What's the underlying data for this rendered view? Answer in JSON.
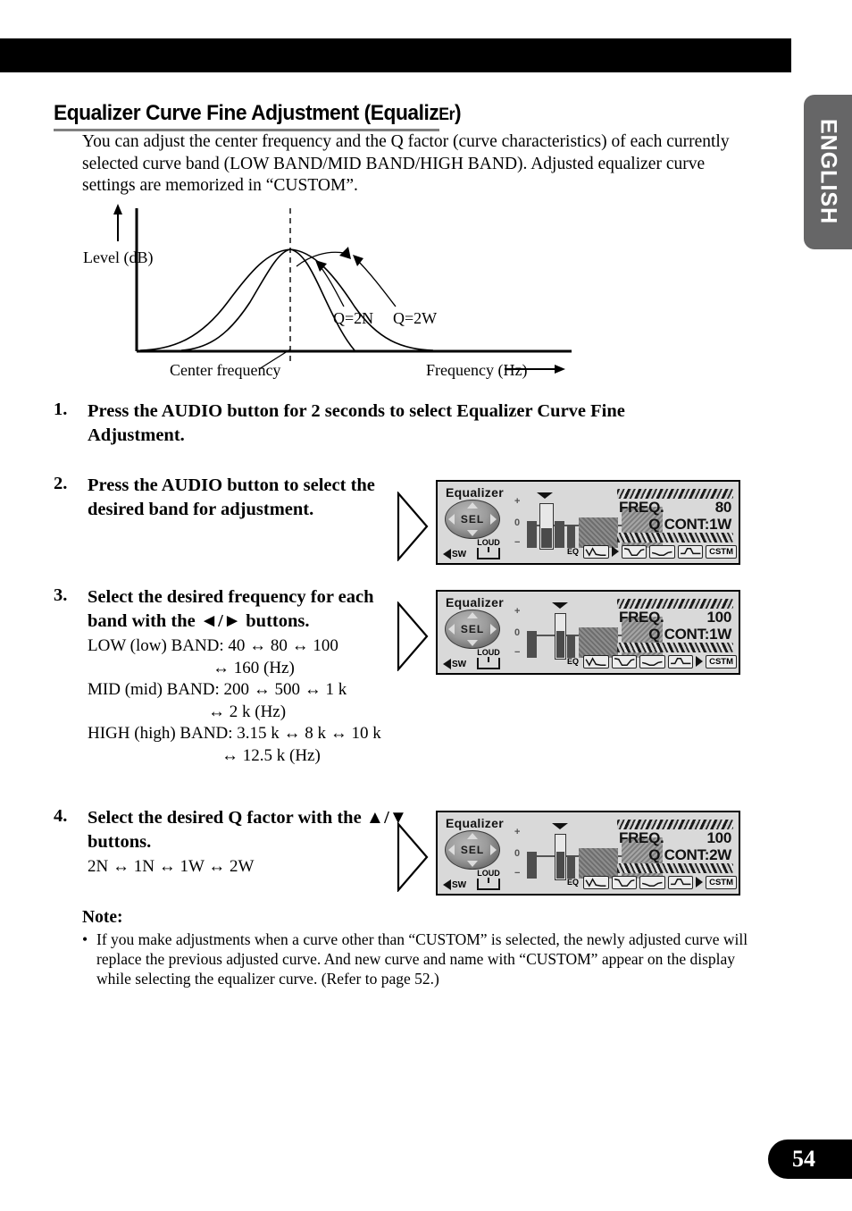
{
  "page": {
    "number": "54",
    "language_tab": "ENGLISH"
  },
  "heading": {
    "main": "Equalizer Curve Fine Adjustment (Equaliz",
    "smallcap": "Er",
    "close": ")"
  },
  "intro": "You can adjust the center frequency and the Q factor (curve characteristics) of each currently selected curve band (LOW BAND/MID BAND/HIGH BAND). Adjusted equalizer curve settings are memorized in “CUSTOM”.",
  "figure": {
    "y_axis_label": "Level (dB)",
    "x_axis_label": "Frequency (Hz)",
    "center_label": "Center frequency",
    "curve_narrow_label": "Q=2N",
    "curve_wide_label": "Q=2W"
  },
  "steps": [
    {
      "num": "1.",
      "title": "Press the AUDIO button for 2 seconds to select Equalizer Curve Fine Adjustment.",
      "sub": []
    },
    {
      "num": "2.",
      "title": "Press the AUDIO button to select the desired band for adjustment.",
      "sub": []
    },
    {
      "num": "3.",
      "title": "Select the desired frequency for each band with the ◄/► buttons.",
      "sub": [
        {
          "lead": "LOW (low) BAND: 40 ↔ 80 ↔ 100",
          "cont": "↔ 160 (Hz)"
        },
        {
          "lead": "MID (mid) BAND: 200 ↔ 500 ↔ 1 k",
          "cont": "↔ 2 k (Hz)"
        },
        {
          "lead": "HIGH (high) BAND: 3.15 k ↔ 8 k ↔ 10 k",
          "cont": "↔ 12.5 k (Hz)"
        }
      ]
    },
    {
      "num": "4.",
      "title": "Select the desired Q factor with the ▲/▼ buttons.",
      "sub": [
        {
          "lead": "2N ↔ 1N ↔ 1W ↔ 2W",
          "cont": ""
        }
      ]
    }
  ],
  "displays": [
    {
      "id": "display-step2",
      "title": "Equalizer",
      "joypad_label": "SEL",
      "sw_label": "SW",
      "loud_label": "LOUD",
      "scale_plus": "+",
      "scale_zero": "0",
      "scale_minus": "−",
      "eq_label": "EQ",
      "custom_label": "CSTM",
      "freq_label": "FREQ.",
      "freq_value": "80",
      "q_label": "Q CONT:",
      "q_value": "1W",
      "selected_bar": 1,
      "eq_marker_after": 0
    },
    {
      "id": "display-step3",
      "title": "Equalizer",
      "joypad_label": "SEL",
      "sw_label": "SW",
      "loud_label": "LOUD",
      "scale_plus": "+",
      "scale_zero": "0",
      "scale_minus": "−",
      "eq_label": "EQ",
      "custom_label": "CSTM",
      "freq_label": "FREQ.",
      "freq_value": "100",
      "q_label": "Q CONT:",
      "q_value": "1W",
      "selected_bar": 2,
      "eq_marker_after": 3
    },
    {
      "id": "display-step4",
      "title": "Equalizer",
      "joypad_label": "SEL",
      "sw_label": "SW",
      "loud_label": "LOUD",
      "scale_plus": "+",
      "scale_zero": "0",
      "scale_minus": "−",
      "eq_label": "EQ",
      "custom_label": "CSTM",
      "freq_label": "FREQ.",
      "freq_value": "100",
      "q_label": "Q CONT:",
      "q_value": "2W",
      "selected_bar": 2,
      "eq_marker_after": 3
    }
  ],
  "note": {
    "heading": "Note:",
    "bullet": "•",
    "text": "If you make adjustments when a curve other than “CUSTOM” is selected, the newly adjusted curve will replace the previous adjusted curve. And new curve and name with “CUSTOM” appear on the display while selecting the equalizer curve. (Refer to page 52.)"
  }
}
